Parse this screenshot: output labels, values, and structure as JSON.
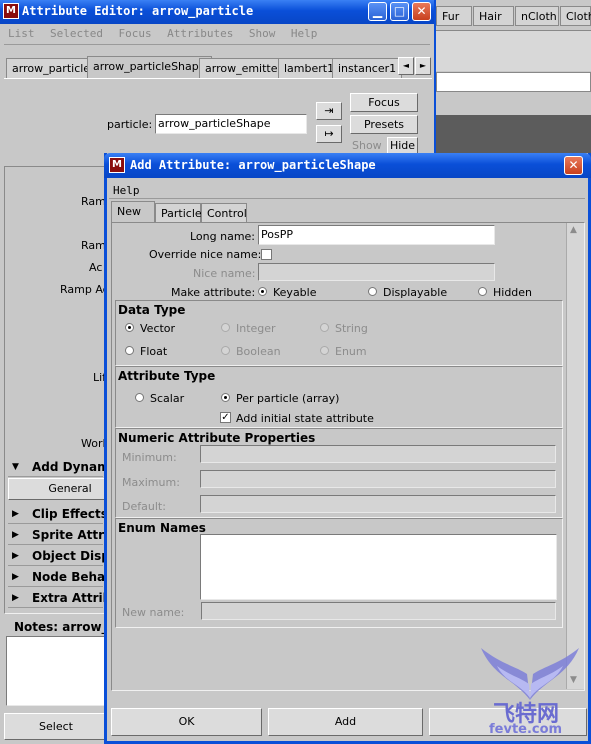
{
  "attr_editor": {
    "title": "Attribute Editor: arrow_particle",
    "menu": [
      "List",
      "Selected",
      "Focus",
      "Attributes",
      "Show",
      "Help"
    ],
    "tabs": [
      "arrow_particle",
      "arrow_particleShape",
      "arrow_emitter",
      "lambert1",
      "instancer1"
    ],
    "tab_prev": "◄",
    "tab_next": "►",
    "particle_label": "particle:",
    "particle_value": "arrow_particleShape",
    "focus_button": "Focus",
    "presets_button": "Presets",
    "show_button": "Show",
    "hide_button": "Hide",
    "partial_labels": [
      "Ram",
      "Ram",
      "Ac",
      "Ramp Ac",
      "Lif",
      "Worl"
    ],
    "add_dynamic": "Add Dynam",
    "general_button": "General",
    "frames": [
      "Clip Effects",
      "Sprite Attri",
      "Object Disp",
      "Node Behav",
      "Extra Attrib"
    ],
    "notes_label": "Notes:  arrow_",
    "select_button": "Select"
  },
  "shelf": {
    "tabs": [
      "Fur",
      "Hair",
      "nCloth",
      "Cloth"
    ]
  },
  "dialog": {
    "title": "Add Attribute: arrow_particleShape",
    "menu_help": "Help",
    "tabs": [
      "New",
      "Particle",
      "Control"
    ],
    "long_name_label": "Long name:",
    "long_name_value": "PosPP",
    "override_label": "Override nice name:",
    "nice_name_label": "Nice name:",
    "make_attr_label": "Make attribute:",
    "make_attr_options": [
      "Keyable",
      "Displayable",
      "Hidden"
    ],
    "data_type_title": "Data Type",
    "data_types": [
      "Vector",
      "Integer",
      "String",
      "Float",
      "Boolean",
      "Enum"
    ],
    "attr_type_title": "Attribute Type",
    "attr_types": [
      "Scalar",
      "Per particle (array)"
    ],
    "initial_state_label": "Add initial state attribute",
    "numeric_title": "Numeric Attribute Properties",
    "numeric_fields": [
      "Minimum:",
      "Maximum:",
      "Default:"
    ],
    "enum_title": "Enum Names",
    "new_name_label": "New name:",
    "ok_button": "OK",
    "add_button": "Add"
  },
  "watermark": {
    "text": "飞特网",
    "url": "fevte.com"
  }
}
